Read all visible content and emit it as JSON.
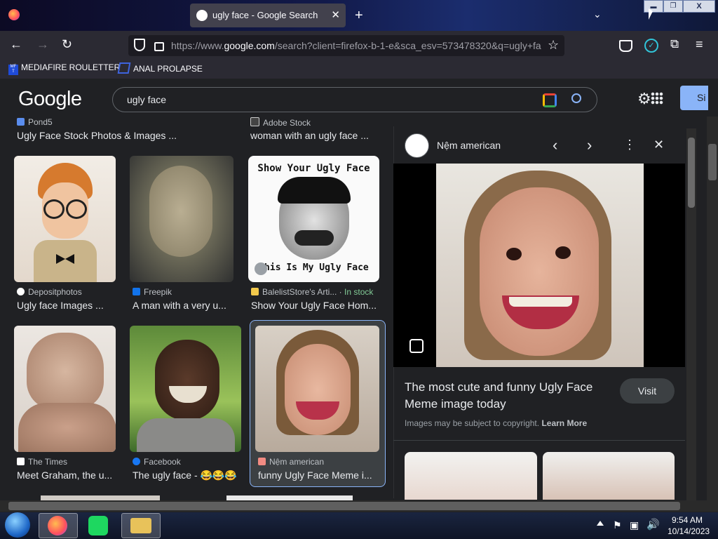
{
  "window": {
    "tab_title": "ugly face - Google Search",
    "minimize": "▬",
    "maximize": "❐",
    "close": "X"
  },
  "nav": {
    "url_prefix": "https://www.",
    "url_domain": "google.com",
    "url_rest": "/search?client=firefox-b-1-e&sca_esv=573478320&q=ugly+fa"
  },
  "bookmarks": [
    {
      "label": "MEDIAFIRE ROULETTER"
    },
    {
      "label": "ANAL PROLAPSE"
    }
  ],
  "google": {
    "logo": "Google",
    "query": "ugly face",
    "signin_label": "Si"
  },
  "results_top": [
    {
      "source": "Pond5",
      "title": "Ugly Face Stock Photos & Images ..."
    },
    {
      "source": "Adobe Stock",
      "title": "woman with an ugly face ..."
    }
  ],
  "results_row1": [
    {
      "source": "Depositphotos",
      "title": "Ugly face Images ..."
    },
    {
      "source": "Freepik",
      "title": "A man with a very u..."
    },
    {
      "source": "BalelistStore's Arti...",
      "badge": "In stock",
      "title": "Show Your Ugly Face Hom...",
      "poster_top": "Show Your Ugly Face",
      "poster_bottom": "This Is My Ugly Face"
    }
  ],
  "results_row2": [
    {
      "source": "The Times",
      "title": "Meet Graham, the u..."
    },
    {
      "source": "Facebook",
      "title": "The ugly face - 😂😂😂..."
    },
    {
      "source": "Nệm american",
      "title": "funny Ugly Face Meme i..."
    }
  ],
  "panel": {
    "source": "Nệm american",
    "title": "The most cute and funny Ugly Face Meme image today",
    "visit_label": "Visit",
    "copyright": "Images may be subject to copyright.",
    "learn_more": "Learn More"
  },
  "taskbar": {
    "time": "9:54 AM",
    "date": "10/14/2023"
  }
}
